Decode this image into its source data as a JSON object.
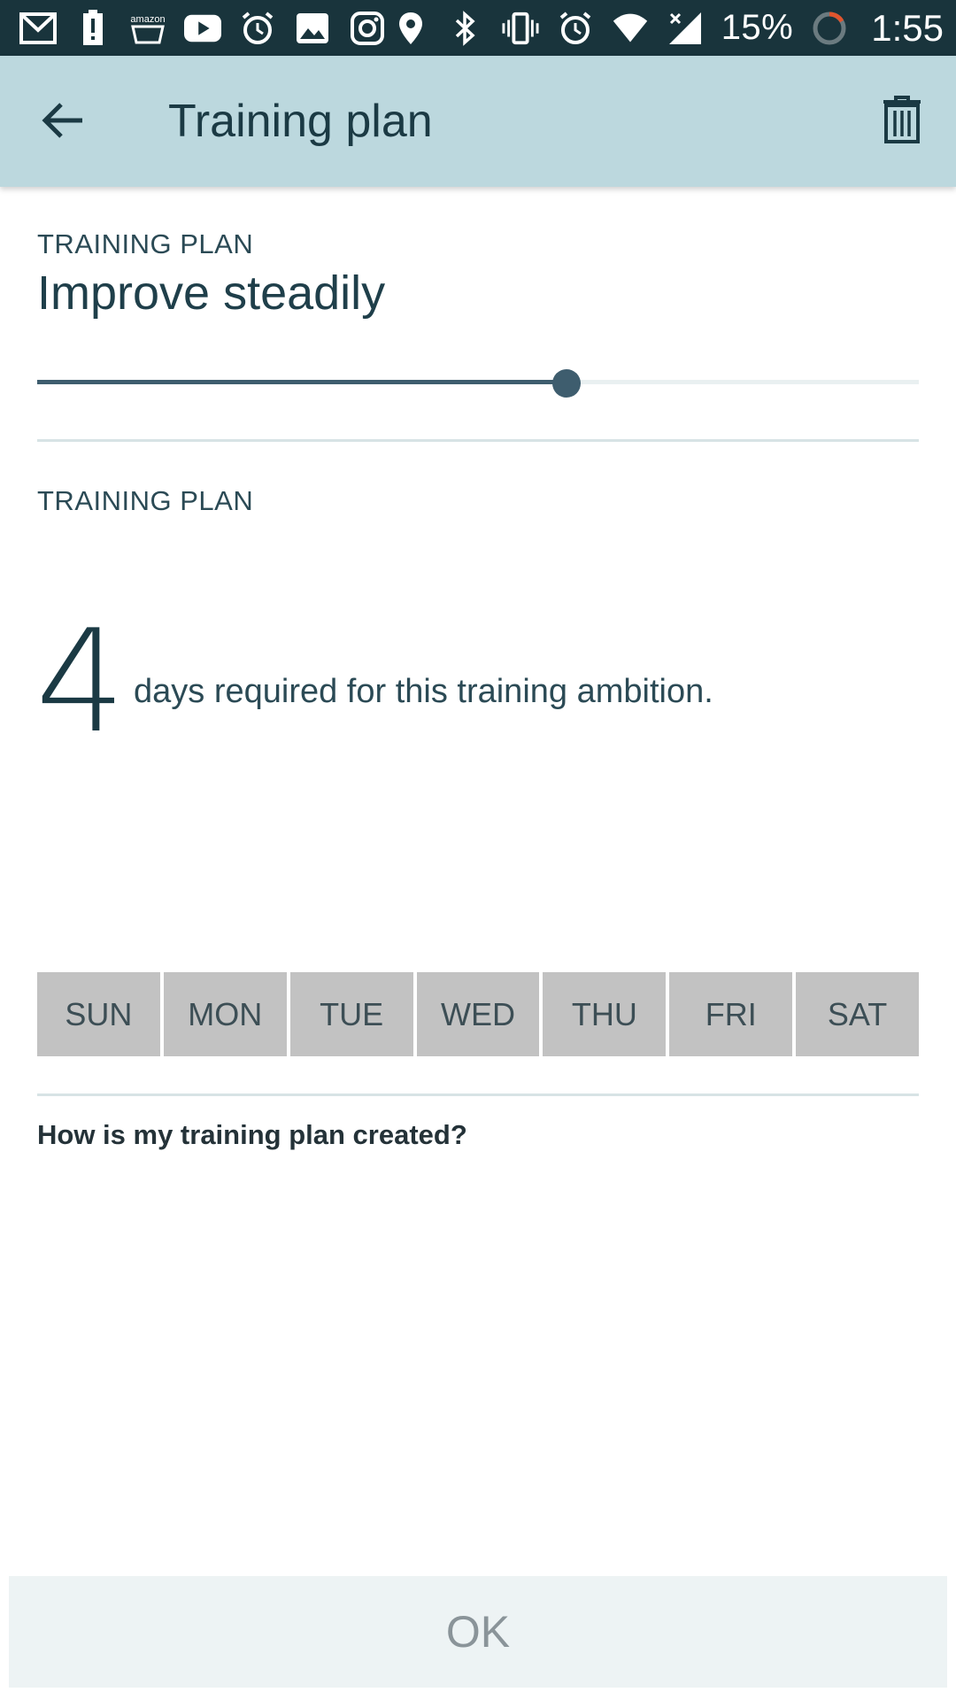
{
  "status_bar": {
    "battery_percent": "15%",
    "time": "1:55",
    "left_icons": [
      "gmail-icon",
      "alert-battery-icon",
      "amazon-icon",
      "youtube-icon",
      "alarm-icon",
      "gallery-icon",
      "instagram-icon"
    ],
    "right_icons": [
      "location-icon",
      "bluetooth-icon",
      "vibrate-icon",
      "alarm-icon",
      "wifi-icon",
      "signal-icon",
      "battery-ring-icon"
    ]
  },
  "app_bar": {
    "title": "Training plan"
  },
  "plan_section": {
    "label": "TRAINING PLAN",
    "value": "Improve steadily",
    "slider_fraction": 0.6
  },
  "days_section": {
    "label": "TRAINING PLAN",
    "days_count": "4",
    "days_text": "days required for this training ambition."
  },
  "days": [
    {
      "label": "SUN"
    },
    {
      "label": "MON"
    },
    {
      "label": "TUE"
    },
    {
      "label": "WED"
    },
    {
      "label": "THU"
    },
    {
      "label": "FRI"
    },
    {
      "label": "SAT"
    }
  ],
  "help_link": "How is my training plan created?",
  "ok_button": "OK",
  "colors": {
    "status_bar": "#19343c",
    "app_bar": "#bcd8de",
    "accent": "#3e5d6e",
    "day_button": "#c2c2c2",
    "ok_button_bg": "#edf3f4"
  }
}
